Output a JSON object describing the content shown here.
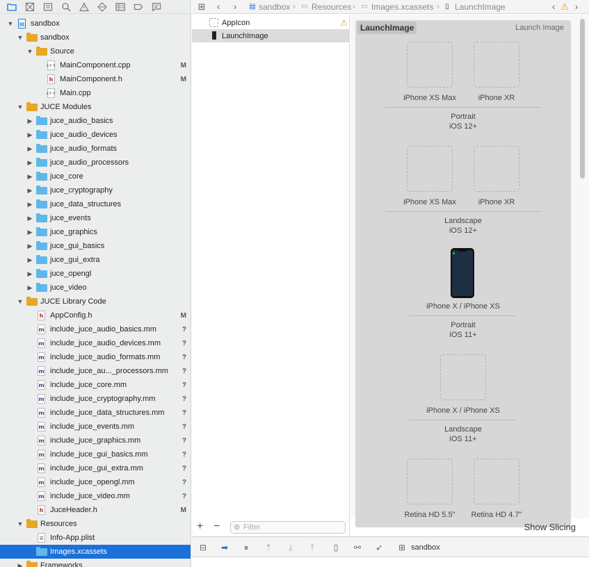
{
  "navigator": {
    "toolbar_icons": [
      "folder-icon",
      "source-control-icon",
      "symbol-icon",
      "find-icon",
      "issue-icon",
      "test-icon",
      "debug-icon",
      "breakpoint-icon",
      "report-icon"
    ],
    "tree": [
      {
        "label": "sandbox",
        "level": 0,
        "kind": "project",
        "expanded": true,
        "status": ""
      },
      {
        "label": "sandbox",
        "level": 1,
        "kind": "folder-yellow",
        "expanded": true,
        "status": ""
      },
      {
        "label": "Source",
        "level": 2,
        "kind": "folder-yellow",
        "expanded": true,
        "status": ""
      },
      {
        "label": "MainComponent.cpp",
        "level": 3,
        "kind": "cpp",
        "status": "M"
      },
      {
        "label": "MainComponent.h",
        "level": 3,
        "kind": "h",
        "status": "M"
      },
      {
        "label": "Main.cpp",
        "level": 3,
        "kind": "cpp",
        "status": ""
      },
      {
        "label": "JUCE Modules",
        "level": 1,
        "kind": "folder-yellow",
        "expanded": true,
        "status": ""
      },
      {
        "label": "juce_audio_basics",
        "level": 2,
        "kind": "folder-blue",
        "expanded": false,
        "status": ""
      },
      {
        "label": "juce_audio_devices",
        "level": 2,
        "kind": "folder-blue",
        "expanded": false,
        "status": ""
      },
      {
        "label": "juce_audio_formats",
        "level": 2,
        "kind": "folder-blue",
        "expanded": false,
        "status": ""
      },
      {
        "label": "juce_audio_processors",
        "level": 2,
        "kind": "folder-blue",
        "expanded": false,
        "status": ""
      },
      {
        "label": "juce_core",
        "level": 2,
        "kind": "folder-blue",
        "expanded": false,
        "status": ""
      },
      {
        "label": "juce_cryptography",
        "level": 2,
        "kind": "folder-blue",
        "expanded": false,
        "status": ""
      },
      {
        "label": "juce_data_structures",
        "level": 2,
        "kind": "folder-blue",
        "expanded": false,
        "status": ""
      },
      {
        "label": "juce_events",
        "level": 2,
        "kind": "folder-blue",
        "expanded": false,
        "status": ""
      },
      {
        "label": "juce_graphics",
        "level": 2,
        "kind": "folder-blue",
        "expanded": false,
        "status": ""
      },
      {
        "label": "juce_gui_basics",
        "level": 2,
        "kind": "folder-blue",
        "expanded": false,
        "status": ""
      },
      {
        "label": "juce_gui_extra",
        "level": 2,
        "kind": "folder-blue",
        "expanded": false,
        "status": ""
      },
      {
        "label": "juce_opengl",
        "level": 2,
        "kind": "folder-blue",
        "expanded": false,
        "status": ""
      },
      {
        "label": "juce_video",
        "level": 2,
        "kind": "folder-blue",
        "expanded": false,
        "status": ""
      },
      {
        "label": "JUCE Library Code",
        "level": 1,
        "kind": "folder-yellow",
        "expanded": true,
        "status": ""
      },
      {
        "label": "AppConfig.h",
        "level": 2,
        "kind": "h",
        "status": "M"
      },
      {
        "label": "include_juce_audio_basics.mm",
        "level": 2,
        "kind": "m",
        "status": "?"
      },
      {
        "label": "include_juce_audio_devices.mm",
        "level": 2,
        "kind": "m",
        "status": "?"
      },
      {
        "label": "include_juce_audio_formats.mm",
        "level": 2,
        "kind": "m",
        "status": "?"
      },
      {
        "label": "include_juce_au..._processors.mm",
        "level": 2,
        "kind": "m",
        "status": "?"
      },
      {
        "label": "include_juce_core.mm",
        "level": 2,
        "kind": "m",
        "status": "?"
      },
      {
        "label": "include_juce_cryptography.mm",
        "level": 2,
        "kind": "m",
        "status": "?"
      },
      {
        "label": "include_juce_data_structures.mm",
        "level": 2,
        "kind": "m",
        "status": "?"
      },
      {
        "label": "include_juce_events.mm",
        "level": 2,
        "kind": "m",
        "status": "?"
      },
      {
        "label": "include_juce_graphics.mm",
        "level": 2,
        "kind": "m",
        "status": "?"
      },
      {
        "label": "include_juce_gui_basics.mm",
        "level": 2,
        "kind": "m",
        "status": "?"
      },
      {
        "label": "include_juce_gui_extra.mm",
        "level": 2,
        "kind": "m",
        "status": "?"
      },
      {
        "label": "include_juce_opengl.mm",
        "level": 2,
        "kind": "m",
        "status": "?"
      },
      {
        "label": "include_juce_video.mm",
        "level": 2,
        "kind": "m",
        "status": "?"
      },
      {
        "label": "JuceHeader.h",
        "level": 2,
        "kind": "h",
        "status": "M"
      },
      {
        "label": "Resources",
        "level": 1,
        "kind": "folder-yellow",
        "expanded": true,
        "status": ""
      },
      {
        "label": "Info-App.plist",
        "level": 2,
        "kind": "plist",
        "status": ""
      },
      {
        "label": "Images.xcassets",
        "level": 2,
        "kind": "folder-blue",
        "status": "",
        "selected": true
      },
      {
        "label": "Frameworks",
        "level": 1,
        "kind": "folder-yellow",
        "expanded": false,
        "status": ""
      }
    ]
  },
  "breadcrumb": {
    "items": [
      "sandbox",
      "Resources",
      "Images.xcassets",
      "LaunchImage"
    ]
  },
  "asset_list": {
    "items": [
      {
        "label": "AppIcon",
        "warning": true
      },
      {
        "label": "LaunchImage",
        "selected": true
      }
    ],
    "filter_placeholder": "Filter",
    "add_label": "+",
    "remove_label": "−"
  },
  "asset_detail": {
    "title": "LaunchImage",
    "type_label": "Launch Image",
    "slots": [
      "iPhone XS Max",
      "iPhone XR",
      "iPhone XS Max",
      "iPhone XR",
      "iPhone X / iPhone XS",
      "iPhone X / iPhone XS",
      "Retina HD 5.5\"",
      "Retina HD 4.7\""
    ],
    "groups": [
      {
        "orientation": "Portrait",
        "os": "iOS 12+"
      },
      {
        "orientation": "Landscape",
        "os": "iOS 12+"
      },
      {
        "orientation": "Portrait",
        "os": "iOS 11+"
      },
      {
        "orientation": "Landscape",
        "os": "iOS 11+"
      }
    ],
    "show_slicing_label": "Show Slicing"
  },
  "debug_bar": {
    "scheme": "sandbox"
  },
  "colors": {
    "selection": "#1b70d9",
    "folder_yellow": "#e7a727",
    "folder_blue": "#5fb7ea",
    "warning": "#e5a50a"
  }
}
